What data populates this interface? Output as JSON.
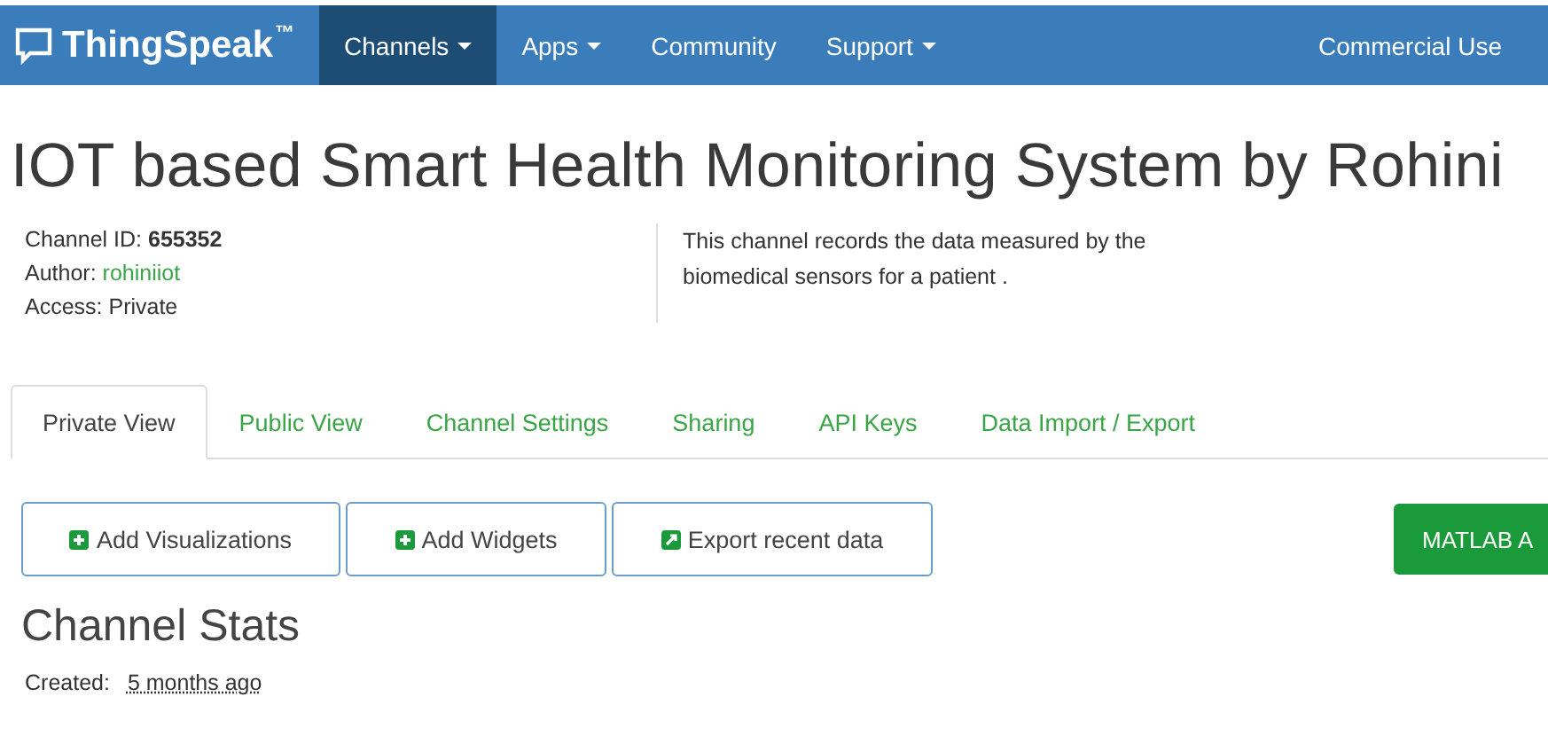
{
  "navbar": {
    "brand": "ThingSpeak",
    "trademark": "™",
    "items": [
      {
        "label": "Channels",
        "dropdown": true,
        "selected": true
      },
      {
        "label": "Apps",
        "dropdown": true,
        "selected": false
      },
      {
        "label": "Community",
        "dropdown": false,
        "selected": false
      },
      {
        "label": "Support",
        "dropdown": true,
        "selected": false
      }
    ],
    "right_link": "Commercial Use"
  },
  "title": "IOT based Smart Health Monitoring System by Rohini",
  "info": {
    "channel_id_label": "Channel ID:",
    "channel_id": "655352",
    "author_label": "Author:",
    "author": "rohiniiot",
    "access": "Access: Private",
    "description": "This channel records the data measured by the biomedical sensors for a patient ."
  },
  "tabs": [
    {
      "label": "Private View",
      "selected": true
    },
    {
      "label": "Public View",
      "selected": false
    },
    {
      "label": "Channel Settings",
      "selected": false
    },
    {
      "label": "Sharing",
      "selected": false
    },
    {
      "label": "API Keys",
      "selected": false
    },
    {
      "label": "Data Import / Export",
      "selected": false
    }
  ],
  "buttons": [
    {
      "label": "Add Visualizations",
      "kind": "add"
    },
    {
      "label": "Add Widgets",
      "kind": "add"
    },
    {
      "label": "Export recent data",
      "kind": "export"
    }
  ],
  "matlab_button": "MATLAB A",
  "stats": {
    "heading": "Channel Stats",
    "created_label": "Created:",
    "created": "5 months ago"
  }
}
